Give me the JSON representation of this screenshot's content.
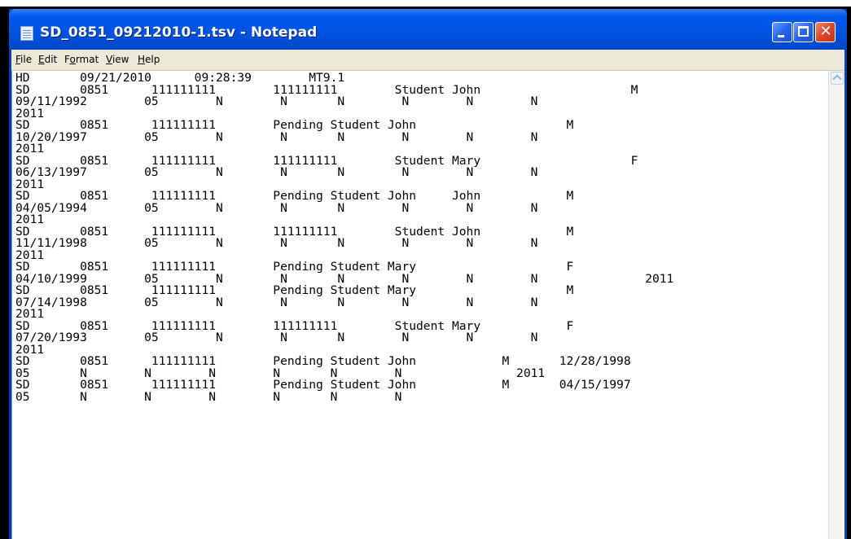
{
  "window": {
    "title": "SD_0851_09212010-1.tsv - Notepad",
    "app_icon": "notepad-icon",
    "controls": {
      "minimize_icon": "minimize-icon",
      "maximize_icon": "maximize-icon",
      "close_icon": "close-icon",
      "close_glyph": "✕"
    }
  },
  "menu": {
    "items": [
      {
        "accel": "F",
        "rest": "ile"
      },
      {
        "accel": "E",
        "rest": "dit"
      },
      {
        "before": "F",
        "accel": "o",
        "rest": "rmat"
      },
      {
        "accel": "V",
        "rest": "iew"
      },
      {
        "accel": "H",
        "rest": "elp"
      }
    ]
  },
  "document": {
    "lines": [
      "HD       09/21/2010      09:28:39        MT9.1",
      "SD       0851      111111111        111111111        Student John                     M",
      "09/11/1992        05        N        N       N        N        N        N",
      "2011",
      "SD       0851      111111111        Pending Student John                     M",
      "10/20/1997        05        N        N       N        N        N        N",
      "2011",
      "SD       0851      111111111        111111111        Student Mary                     F",
      "06/13/1997        05        N        N       N        N        N        N",
      "2011",
      "SD       0851      111111111        Pending Student John     John            M",
      "04/05/1994        05        N        N       N        N        N        N",
      "2011",
      "SD       0851      111111111        111111111        Student John            M",
      "11/11/1998        05        N        N       N        N        N        N",
      "2011",
      "SD       0851      111111111        Pending Student Mary                     F",
      "04/10/1999        05        N        N       N        N        N        N               2011",
      "SD       0851      111111111        Pending Student Mary                     M",
      "07/14/1998        05        N        N       N        N        N        N",
      "2011",
      "SD       0851      111111111        111111111        Student Mary            F",
      "07/20/1993        05        N        N       N        N        N        N",
      "2011",
      "SD       0851      111111111        Pending Student John            M       12/28/1998",
      "05       N        N        N        N       N        N                2011",
      "SD       0851      111111111        Pending Student John            M       04/15/1997",
      "05       N        N        N        N       N        N"
    ]
  },
  "scrollbar": {
    "up_icon": "scroll-up-arrow-icon"
  }
}
